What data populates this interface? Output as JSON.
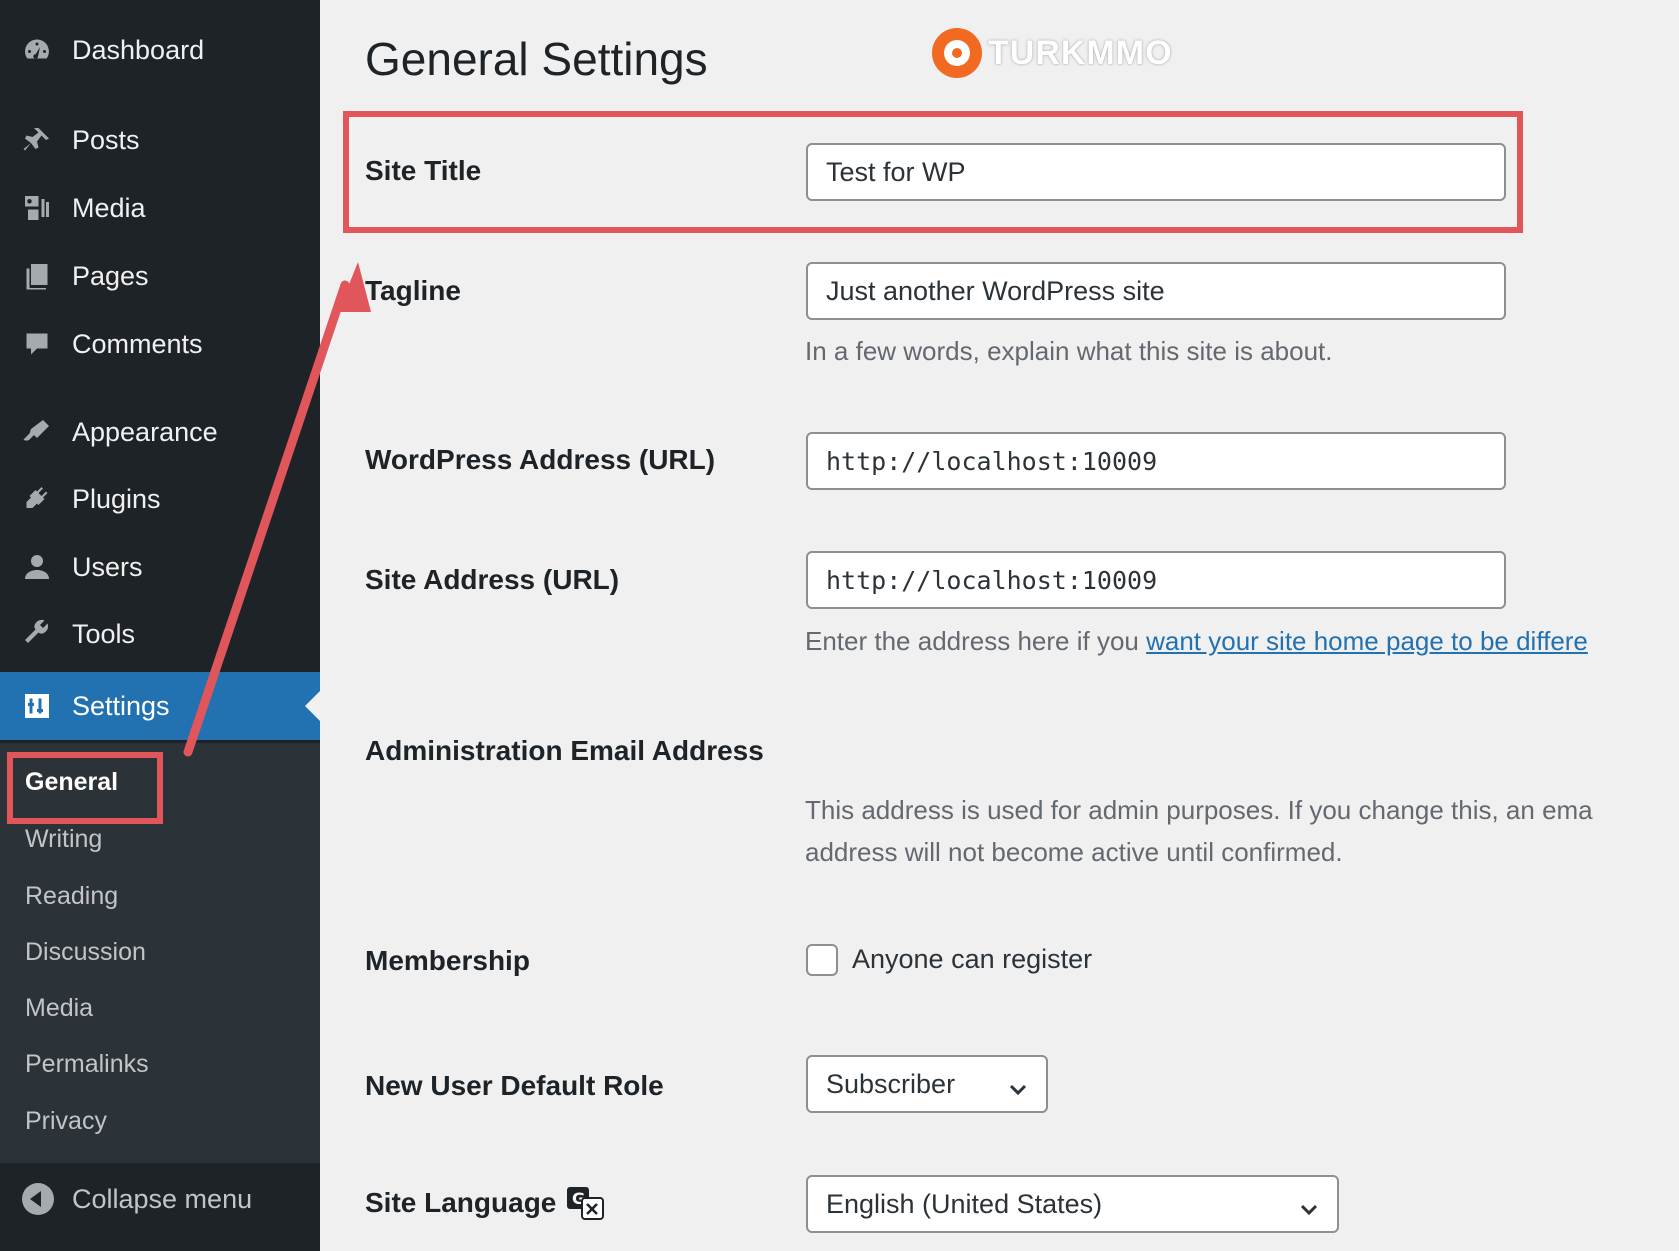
{
  "sidebar": {
    "items": [
      {
        "label": "Dashboard",
        "icon": "dashboard-icon"
      },
      {
        "label": "Posts",
        "icon": "pin-icon"
      },
      {
        "label": "Media",
        "icon": "media-icon"
      },
      {
        "label": "Pages",
        "icon": "pages-icon"
      },
      {
        "label": "Comments",
        "icon": "comment-icon"
      },
      {
        "label": "Appearance",
        "icon": "brush-icon"
      },
      {
        "label": "Plugins",
        "icon": "plugin-icon"
      },
      {
        "label": "Users",
        "icon": "user-icon"
      },
      {
        "label": "Tools",
        "icon": "wrench-icon"
      },
      {
        "label": "Settings",
        "icon": "settings-icon",
        "current": true
      }
    ],
    "submenu": [
      "General",
      "Writing",
      "Reading",
      "Discussion",
      "Media",
      "Permalinks",
      "Privacy"
    ],
    "submenu_active": "General",
    "collapse_label": "Collapse menu"
  },
  "watermark": {
    "text": "TURKMMO"
  },
  "page": {
    "title": "General Settings"
  },
  "fields": {
    "site_title": {
      "label": "Site Title",
      "value": "Test for WP"
    },
    "tagline": {
      "label": "Tagline",
      "value": "Just another WordPress site",
      "description": "In a few words, explain what this site is about."
    },
    "wp_address": {
      "label": "WordPress Address (URL)",
      "value": "http://localhost:10009"
    },
    "site_address": {
      "label": "Site Address (URL)",
      "value": "http://localhost:10009",
      "description_prefix": "Enter the address here if you ",
      "description_link": "want your site home page to be differe"
    },
    "admin_email": {
      "label": "Administration Email Address",
      "description_line1": "This address is used for admin purposes. If you change this, an ema",
      "description_line2": "address will not become active until confirmed."
    },
    "membership": {
      "label": "Membership",
      "checkbox_label": "Anyone can register",
      "checked": false
    },
    "default_role": {
      "label": "New User Default Role",
      "value": "Subscriber"
    },
    "site_language": {
      "label": "Site Language",
      "value": "English (United States)"
    }
  },
  "colors": {
    "sidebar_bg": "#1d2327",
    "submenu_bg": "#2c3338",
    "accent": "#2271b1",
    "highlight": "#e0565b",
    "watermark": "#f26a21"
  }
}
